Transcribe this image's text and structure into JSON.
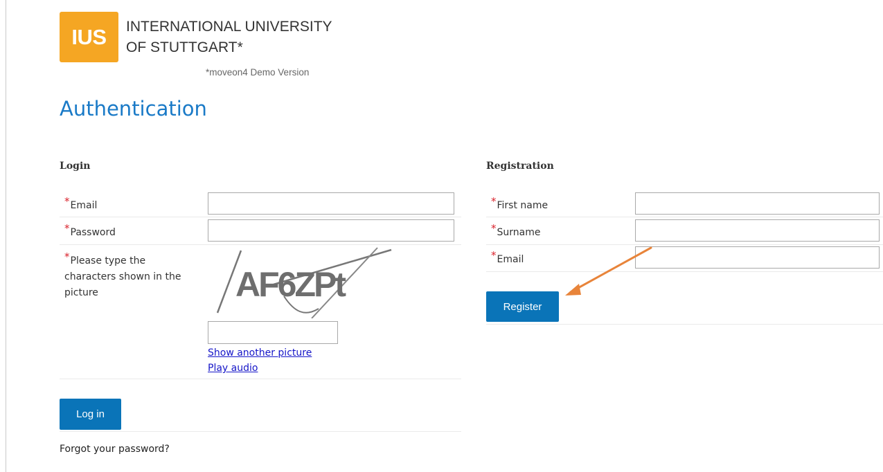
{
  "header": {
    "logo_text": "IUS",
    "university_line1": "INTERNATIONAL UNIVERSITY",
    "university_line2": "OF STUTTGART*",
    "demo_note": "*moveon4 Demo Version",
    "logo_color": "#f5a623"
  },
  "page": {
    "title": "Authentication",
    "title_color": "#1a7ac7",
    "accent_button_color": "#0a74b8",
    "required_marker": "*",
    "required_color": "#d9232d"
  },
  "login": {
    "section_title": "Login",
    "email_label": "Email",
    "email_value": "",
    "password_label": "Password",
    "password_value": "",
    "captcha_label": "Please type the characters shown in the picture",
    "captcha_text": "AF6ZPt",
    "captcha_input_value": "",
    "show_another_picture": "Show another picture",
    "play_audio": "Play audio",
    "login_button": "Log in",
    "forgot_password": "Forgot your password?"
  },
  "registration": {
    "section_title": "Registration",
    "first_name_label": "First name",
    "first_name_value": "",
    "surname_label": "Surname",
    "surname_value": "",
    "email_label": "Email",
    "email_value": "",
    "register_button": "Register"
  },
  "annotation": {
    "arrow_color": "#e8843a",
    "arrow_icon": "arrow-pointer-icon"
  }
}
